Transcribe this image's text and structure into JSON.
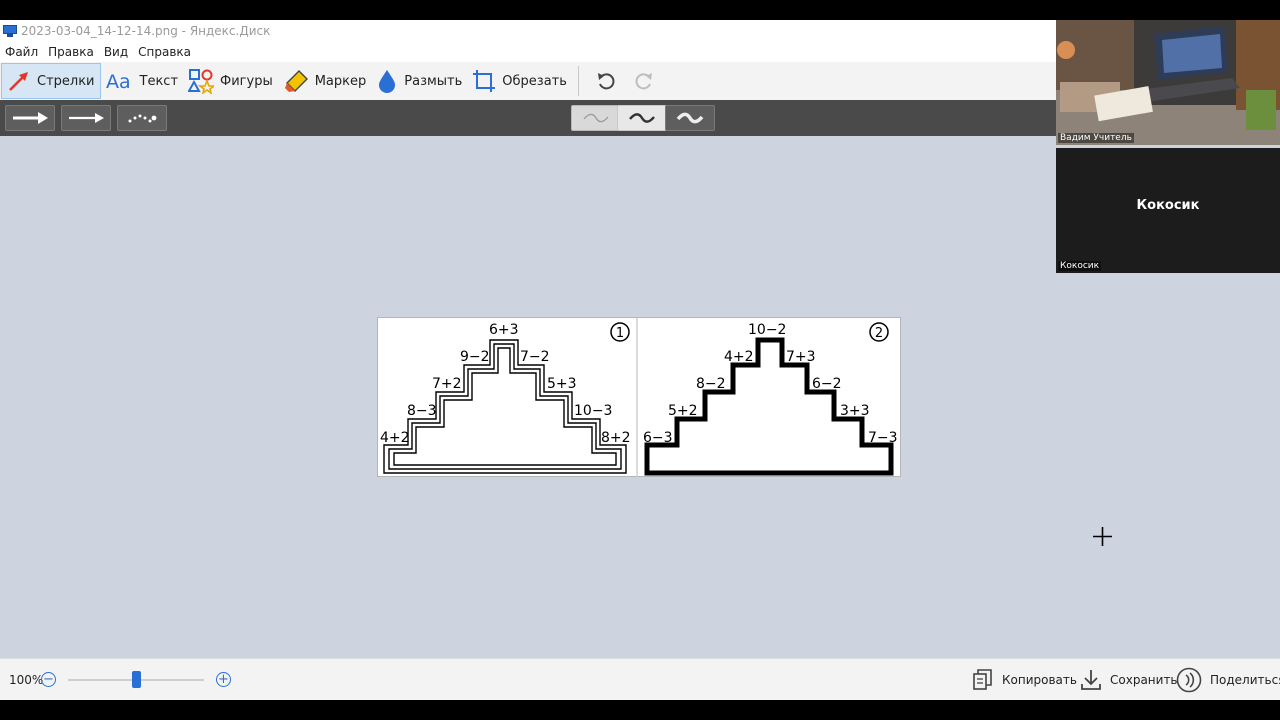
{
  "window": {
    "title": "2023-03-04_14-12-14.png - Яндекс.Диск"
  },
  "menu": {
    "items": [
      "Файл",
      "Правка",
      "Вид",
      "Справка"
    ]
  },
  "toolbar": {
    "tools": [
      {
        "label": "Стрелки",
        "icon": "arrow-icon",
        "active": true
      },
      {
        "label": "Текст",
        "icon": "text-icon"
      },
      {
        "label": "Фигуры",
        "icon": "shapes-icon"
      },
      {
        "label": "Маркер",
        "icon": "marker-icon"
      },
      {
        "label": "Размыть",
        "icon": "blur-icon"
      },
      {
        "label": "Обрезать",
        "icon": "crop-icon"
      }
    ],
    "undo_icon": "undo-icon",
    "redo_icon": "redo-icon"
  },
  "subtoolbar": {
    "arrow_styles": [
      "arrow-solid",
      "arrow-thin",
      "arrow-dotted"
    ],
    "stroke_widths": [
      "thin",
      "medium",
      "thick"
    ]
  },
  "image": {
    "panel_1": {
      "number": "1",
      "labels": [
        "6+3",
        "9−2",
        "7−2",
        "7+2",
        "5+3",
        "8−3",
        "10−3",
        "4+2",
        "8+2"
      ]
    },
    "panel_2": {
      "number": "2",
      "labels": [
        "10−2",
        "4+2",
        "7+3",
        "8−2",
        "6−2",
        "5+2",
        "3+3",
        "6−3",
        "7−3"
      ]
    }
  },
  "status": {
    "zoom": "100%",
    "zoom_level": 0.5,
    "copy_label": "Копировать",
    "save_label": "Сохранить",
    "share_label": "Поделиться"
  },
  "video": {
    "tile1_name": "Вадим Учитель",
    "tile2_center": "Кокосик",
    "tile2_name": "Кокосик"
  },
  "colors": {
    "accent": "#2a6fd6",
    "canvas": "#cdd4df",
    "subtoolbar": "#4a4a4a"
  }
}
